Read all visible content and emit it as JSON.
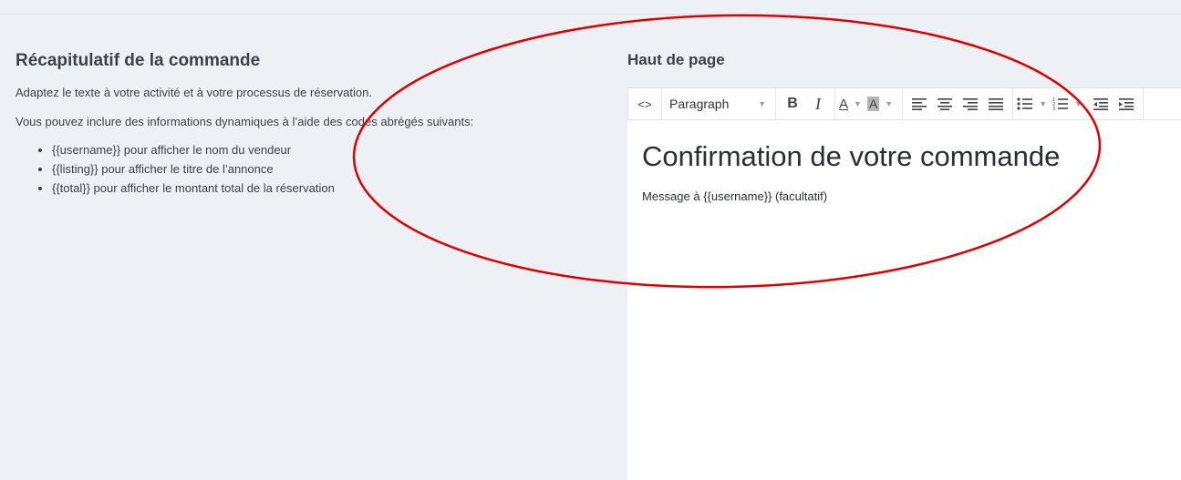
{
  "left": {
    "title": "Récapitulatif de la commande",
    "paragraph1": "Adaptez le texte à votre activité et à votre processus de réservation.",
    "paragraph2": "Vous pouvez inclure des informations dynamiques à l’aide des codes abrégés suivants:",
    "bullets": [
      "{{username}} pour afficher le nom du vendeur",
      "{{listing}} pour afficher le titre de l’annonce",
      "{{total}} pour afficher le montant total de la réservation"
    ]
  },
  "right": {
    "title": "Haut de page"
  },
  "toolbar": {
    "code_icon": "<>",
    "format_select": "Paragraph",
    "bold": "B",
    "italic": "I",
    "font_color": "A",
    "bg_color": "A"
  },
  "editor": {
    "heading": "Confirmation de votre commande",
    "message": "Message à {{username}} (facultatif)"
  },
  "annotation_color": "#e00000"
}
